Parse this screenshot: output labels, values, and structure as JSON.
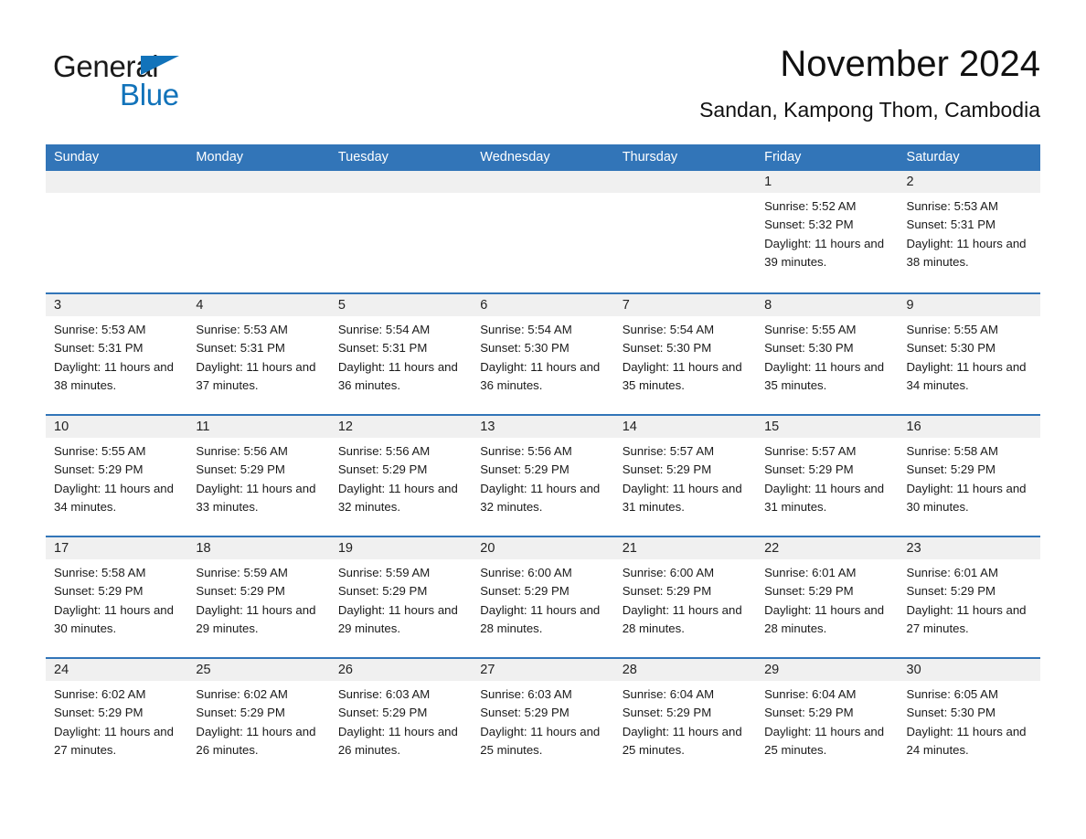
{
  "brand": {
    "name_part1": "General",
    "name_part2": "Blue",
    "triangle_color": "#1273ba"
  },
  "header": {
    "title": "November 2024",
    "subtitle": "Sandan, Kampong Thom, Cambodia"
  },
  "theme": {
    "header_blue": "#3275b8",
    "row_divider_blue": "#3275b8",
    "day_band_gray": "#f0f0f0",
    "page_background": "#ffffff",
    "text_color": "#1a1a1a"
  },
  "weekdays": [
    "Sunday",
    "Monday",
    "Tuesday",
    "Wednesday",
    "Thursday",
    "Friday",
    "Saturday"
  ],
  "weeks": [
    [
      {
        "date": "",
        "info": ""
      },
      {
        "date": "",
        "info": ""
      },
      {
        "date": "",
        "info": ""
      },
      {
        "date": "",
        "info": ""
      },
      {
        "date": "",
        "info": ""
      },
      {
        "date": "1",
        "info": "Sunrise: 5:52 AM\nSunset: 5:32 PM\nDaylight: 11 hours and 39 minutes."
      },
      {
        "date": "2",
        "info": "Sunrise: 5:53 AM\nSunset: 5:31 PM\nDaylight: 11 hours and 38 minutes."
      }
    ],
    [
      {
        "date": "3",
        "info": "Sunrise: 5:53 AM\nSunset: 5:31 PM\nDaylight: 11 hours and 38 minutes."
      },
      {
        "date": "4",
        "info": "Sunrise: 5:53 AM\nSunset: 5:31 PM\nDaylight: 11 hours and 37 minutes."
      },
      {
        "date": "5",
        "info": "Sunrise: 5:54 AM\nSunset: 5:31 PM\nDaylight: 11 hours and 36 minutes."
      },
      {
        "date": "6",
        "info": "Sunrise: 5:54 AM\nSunset: 5:30 PM\nDaylight: 11 hours and 36 minutes."
      },
      {
        "date": "7",
        "info": "Sunrise: 5:54 AM\nSunset: 5:30 PM\nDaylight: 11 hours and 35 minutes."
      },
      {
        "date": "8",
        "info": "Sunrise: 5:55 AM\nSunset: 5:30 PM\nDaylight: 11 hours and 35 minutes."
      },
      {
        "date": "9",
        "info": "Sunrise: 5:55 AM\nSunset: 5:30 PM\nDaylight: 11 hours and 34 minutes."
      }
    ],
    [
      {
        "date": "10",
        "info": "Sunrise: 5:55 AM\nSunset: 5:29 PM\nDaylight: 11 hours and 34 minutes."
      },
      {
        "date": "11",
        "info": "Sunrise: 5:56 AM\nSunset: 5:29 PM\nDaylight: 11 hours and 33 minutes."
      },
      {
        "date": "12",
        "info": "Sunrise: 5:56 AM\nSunset: 5:29 PM\nDaylight: 11 hours and 32 minutes."
      },
      {
        "date": "13",
        "info": "Sunrise: 5:56 AM\nSunset: 5:29 PM\nDaylight: 11 hours and 32 minutes."
      },
      {
        "date": "14",
        "info": "Sunrise: 5:57 AM\nSunset: 5:29 PM\nDaylight: 11 hours and 31 minutes."
      },
      {
        "date": "15",
        "info": "Sunrise: 5:57 AM\nSunset: 5:29 PM\nDaylight: 11 hours and 31 minutes."
      },
      {
        "date": "16",
        "info": "Sunrise: 5:58 AM\nSunset: 5:29 PM\nDaylight: 11 hours and 30 minutes."
      }
    ],
    [
      {
        "date": "17",
        "info": "Sunrise: 5:58 AM\nSunset: 5:29 PM\nDaylight: 11 hours and 30 minutes."
      },
      {
        "date": "18",
        "info": "Sunrise: 5:59 AM\nSunset: 5:29 PM\nDaylight: 11 hours and 29 minutes."
      },
      {
        "date": "19",
        "info": "Sunrise: 5:59 AM\nSunset: 5:29 PM\nDaylight: 11 hours and 29 minutes."
      },
      {
        "date": "20",
        "info": "Sunrise: 6:00 AM\nSunset: 5:29 PM\nDaylight: 11 hours and 28 minutes."
      },
      {
        "date": "21",
        "info": "Sunrise: 6:00 AM\nSunset: 5:29 PM\nDaylight: 11 hours and 28 minutes."
      },
      {
        "date": "22",
        "info": "Sunrise: 6:01 AM\nSunset: 5:29 PM\nDaylight: 11 hours and 28 minutes."
      },
      {
        "date": "23",
        "info": "Sunrise: 6:01 AM\nSunset: 5:29 PM\nDaylight: 11 hours and 27 minutes."
      }
    ],
    [
      {
        "date": "24",
        "info": "Sunrise: 6:02 AM\nSunset: 5:29 PM\nDaylight: 11 hours and 27 minutes."
      },
      {
        "date": "25",
        "info": "Sunrise: 6:02 AM\nSunset: 5:29 PM\nDaylight: 11 hours and 26 minutes."
      },
      {
        "date": "26",
        "info": "Sunrise: 6:03 AM\nSunset: 5:29 PM\nDaylight: 11 hours and 26 minutes."
      },
      {
        "date": "27",
        "info": "Sunrise: 6:03 AM\nSunset: 5:29 PM\nDaylight: 11 hours and 25 minutes."
      },
      {
        "date": "28",
        "info": "Sunrise: 6:04 AM\nSunset: 5:29 PM\nDaylight: 11 hours and 25 minutes."
      },
      {
        "date": "29",
        "info": "Sunrise: 6:04 AM\nSunset: 5:29 PM\nDaylight: 11 hours and 25 minutes."
      },
      {
        "date": "30",
        "info": "Sunrise: 6:05 AM\nSunset: 5:30 PM\nDaylight: 11 hours and 24 minutes."
      }
    ]
  ]
}
